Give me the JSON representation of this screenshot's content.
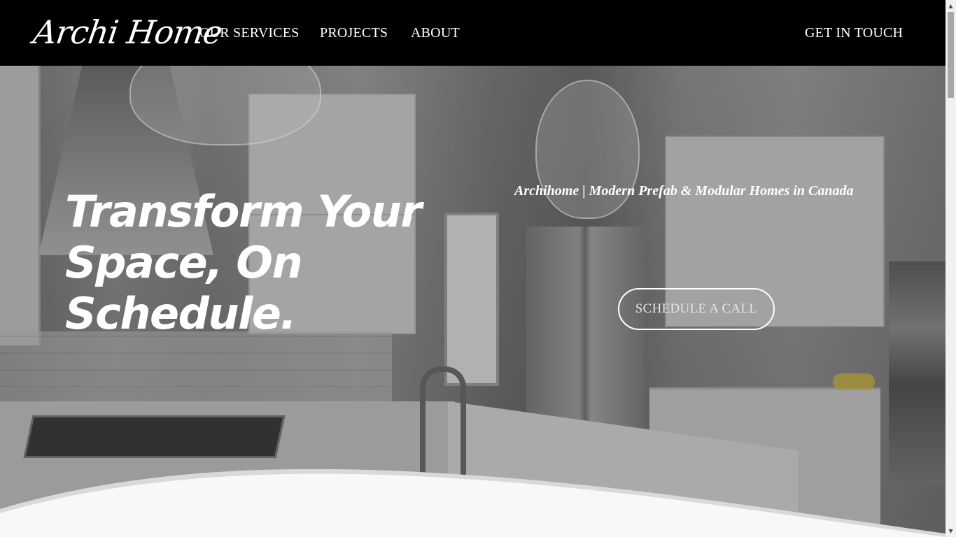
{
  "nav": {
    "logo": "Archi Home",
    "links": [
      "OUR SERVICES",
      "PROJECTS",
      "ABOUT"
    ],
    "contact": "GET IN TOUCH"
  },
  "hero": {
    "headline": "Transform Your Space, On Schedule.",
    "tagline": "Archihome | Modern Prefab & Modular Homes in Canada",
    "cta": "SCHEDULE A CALL"
  },
  "scrollbar": {
    "up_icon": "scroll-up-arrow",
    "down_icon": "scroll-down-arrow"
  },
  "colors": {
    "nav_background": "#000000",
    "text": "#ffffff",
    "wave": "#f8f8f8"
  }
}
